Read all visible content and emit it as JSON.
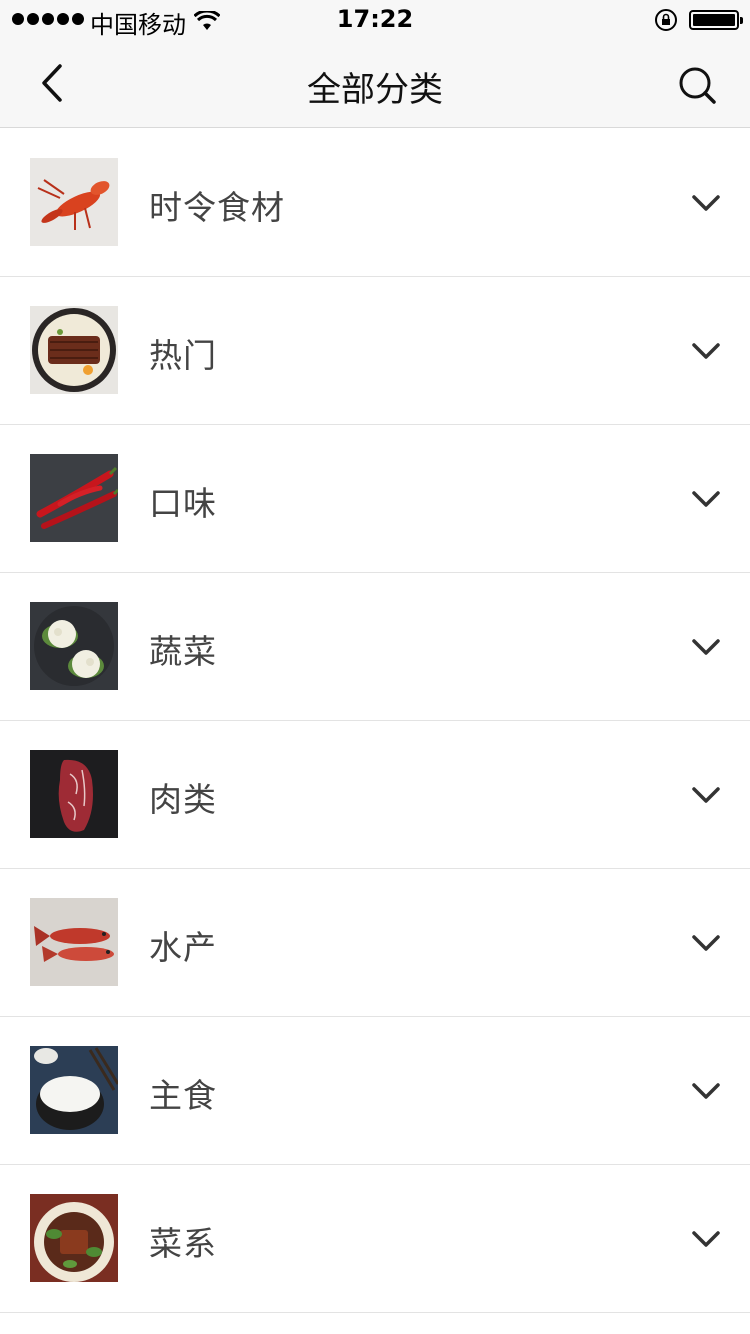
{
  "status_bar": {
    "carrier": "中国移动",
    "time": "17:22"
  },
  "nav": {
    "title": "全部分类"
  },
  "categories": [
    {
      "label": "时令食材",
      "icon": "crayfish-image"
    },
    {
      "label": "热门",
      "icon": "eel-rice-bowl-image"
    },
    {
      "label": "口味",
      "icon": "red-chili-image"
    },
    {
      "label": "蔬菜",
      "icon": "cauliflower-image"
    },
    {
      "label": "肉类",
      "icon": "steak-image"
    },
    {
      "label": "水产",
      "icon": "red-fish-image"
    },
    {
      "label": "主食",
      "icon": "rice-bowl-image"
    },
    {
      "label": "菜系",
      "icon": "braised-pork-dish-image"
    }
  ],
  "colors": {
    "nav_background": "#f7f7f7",
    "divider": "#e3e3e3",
    "label_text": "#444444"
  }
}
